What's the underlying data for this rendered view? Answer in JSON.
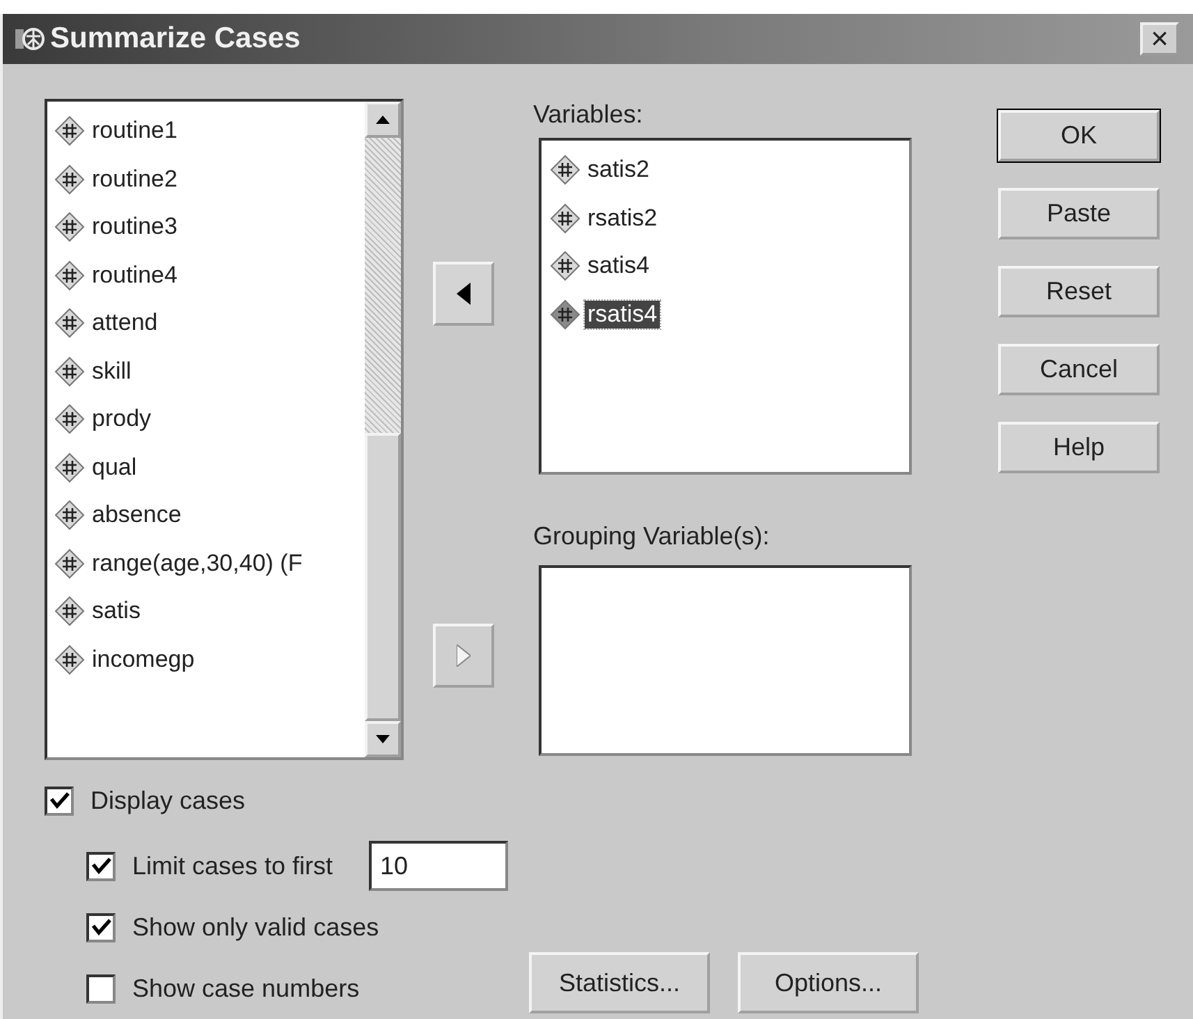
{
  "window": {
    "title": "Summarize Cases",
    "close": "×"
  },
  "source_list": {
    "items": [
      {
        "label": "routine1",
        "selected": false
      },
      {
        "label": "routine2",
        "selected": false
      },
      {
        "label": "routine3",
        "selected": false
      },
      {
        "label": "routine4",
        "selected": false
      },
      {
        "label": "attend",
        "selected": false
      },
      {
        "label": "skill",
        "selected": false
      },
      {
        "label": "prody",
        "selected": false
      },
      {
        "label": "qual",
        "selected": false
      },
      {
        "label": "absence",
        "selected": false
      },
      {
        "label": "range(age,30,40) (F",
        "selected": false
      },
      {
        "label": "satis",
        "selected": false
      },
      {
        "label": "incomegp",
        "selected": false
      }
    ]
  },
  "arrow_buttons": [
    {
      "kind": "left",
      "disabled": false
    },
    {
      "kind": "right",
      "disabled": true
    }
  ],
  "variables": {
    "label": "Variables:",
    "items": [
      {
        "label": "satis2",
        "selected": false
      },
      {
        "label": "rsatis2",
        "selected": false
      },
      {
        "label": "satis4",
        "selected": false
      },
      {
        "label": "rsatis4",
        "selected": true
      }
    ]
  },
  "grouping": {
    "label": "Grouping Variable(s):"
  },
  "buttons": [
    {
      "label": "OK",
      "default": true
    },
    {
      "label": "Paste",
      "default": false
    },
    {
      "label": "Reset",
      "default": false
    },
    {
      "label": "Cancel",
      "default": false
    },
    {
      "label": "Help",
      "default": false
    }
  ],
  "options": [
    {
      "label": "Display cases",
      "checked": true
    },
    {
      "label": "Limit cases to first",
      "checked": true,
      "value": "10"
    },
    {
      "label": "Show only valid cases",
      "checked": true
    },
    {
      "label": "Show case numbers",
      "checked": false
    }
  ],
  "bottom_buttons": [
    {
      "label": "Statistics..."
    },
    {
      "label": "Options..."
    }
  ]
}
